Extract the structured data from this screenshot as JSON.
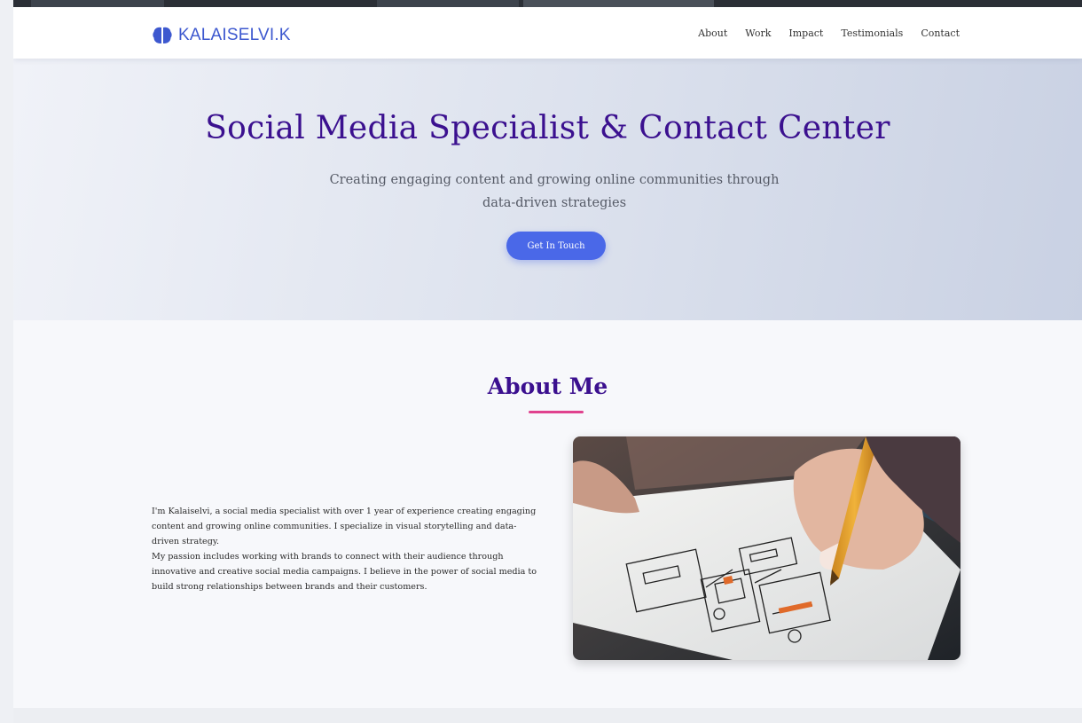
{
  "brand": {
    "name": "KALAISELVI.K",
    "icon": "brain-icon",
    "accent": "#3d58cf"
  },
  "nav": {
    "items": [
      {
        "label": "About"
      },
      {
        "label": "Work"
      },
      {
        "label": "Impact"
      },
      {
        "label": "Testimonials"
      },
      {
        "label": "Contact"
      }
    ]
  },
  "hero": {
    "title": "Social Media Specialist & Contact Center",
    "subtitle": "Creating engaging content and growing online communities through data-driven strategies",
    "cta_label": "Get In Touch",
    "title_color": "#3b108f",
    "cta_color": "#4a68e8"
  },
  "about": {
    "title": "About Me",
    "underline_color": "#e0428e",
    "paragraph1": "I'm Kalaiselvi, a social media specialist with over 1 year of experience creating engaging content and growing online communities. I specialize in visual storytelling and data-driven strategy.",
    "paragraph2": "My passion includes working with brands to connect with their audience through innovative and creative social media campaigns. I believe in the power of social media to build strong relationships between brands and their customers.",
    "image": "hand-sketching-wireframe-photo"
  }
}
